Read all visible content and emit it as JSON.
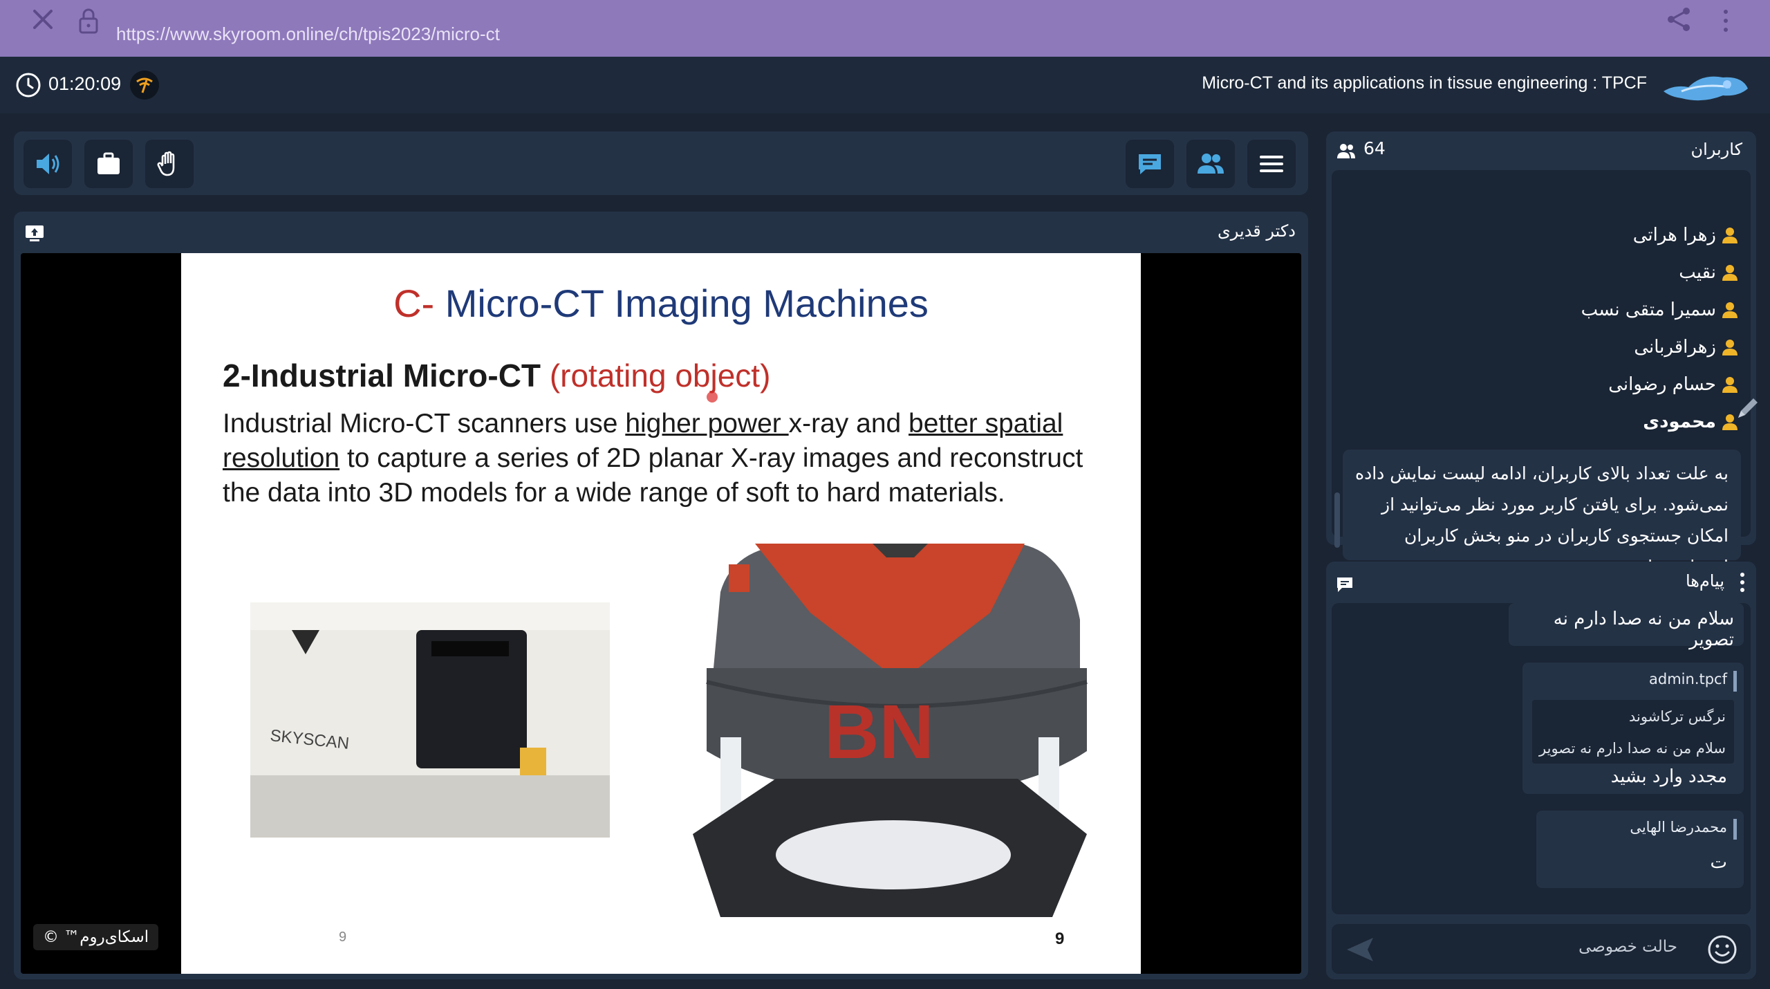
{
  "browser": {
    "url": "https://www.skyroom.online/ch/tpis2023/micro-ct"
  },
  "header": {
    "timer": "01:20:09",
    "course_title": "Micro-CT and its applications in tissue engineering : TPCF"
  },
  "video": {
    "presenter_name": "دکتر قدیری",
    "watermark": "اسکای‌روم™ ©"
  },
  "slide": {
    "title_prefix": "C-",
    "title_rest": " Micro-CT Imaging Machines",
    "subtitle": "2-Industrial Micro-CT",
    "subtitle_paren": "(rotating object)",
    "body_part1": "Industrial Micro-CT scanners use ",
    "body_u1": "higher power ",
    "body_part2": "x-ray and ",
    "body_u2": "better spatial resolution",
    "body_part3": " to capture a series of 2D planar X-ray images and reconstruct the data into 3D models for a wide range of soft to hard materials.",
    "photo_left_label": "SKYSCAN",
    "photo_right_label": "BN",
    "page_num_small": "9",
    "page_num_large": "9"
  },
  "users": {
    "title": "کاربران",
    "count": "64",
    "list": [
      {
        "name": "زهرا هراتی"
      },
      {
        "name": "نقیب"
      },
      {
        "name": "سمیرا متقی نسب"
      },
      {
        "name": "زهراقربانی"
      },
      {
        "name": "حسام رضوانی"
      },
      {
        "name": "محمودی"
      }
    ],
    "note": "به علت تعداد بالای کاربران، ادامه لیست نمایش داده نمی‌شود. برای یافتن کاربر مورد نظر می‌توانید از امکان جستجوی کاربران در منو بخش کاربران استفاده نمایید."
  },
  "messages": {
    "title": "پیام‌ها",
    "items": [
      {
        "text": "سلام من نه صدا دارم نه تصویر"
      },
      {
        "sender": "admin.tpcf",
        "quote_author": "نرگس ترکاشوند",
        "quote_text": "سلام من نه صدا دارم نه تصویر",
        "text": "مجدد وارد بشید"
      },
      {
        "sender": "محمدرضا الهایی",
        "text": "ت"
      }
    ],
    "private_mode_label": "حالت خصوصی"
  },
  "colors": {
    "browser_bar": "#8e79bb",
    "app_bg": "#1a2433",
    "panel": "#243246",
    "accent_blue": "#4aa8e0",
    "slide_title_blue": "#1f3a78",
    "slide_red": "#c0302a"
  },
  "icons": {
    "close": "close-icon",
    "lock": "lock-icon",
    "share": "share-icon",
    "clock": "clock-icon",
    "signal": "signal-icon",
    "speaker": "speaker-icon",
    "briefcase": "briefcase-icon",
    "hand": "raise-hand-icon",
    "chat": "chat-icon",
    "users": "users-icon",
    "menu": "menu-icon",
    "user": "user-icon",
    "emoji": "emoji-icon",
    "send": "send-icon"
  }
}
